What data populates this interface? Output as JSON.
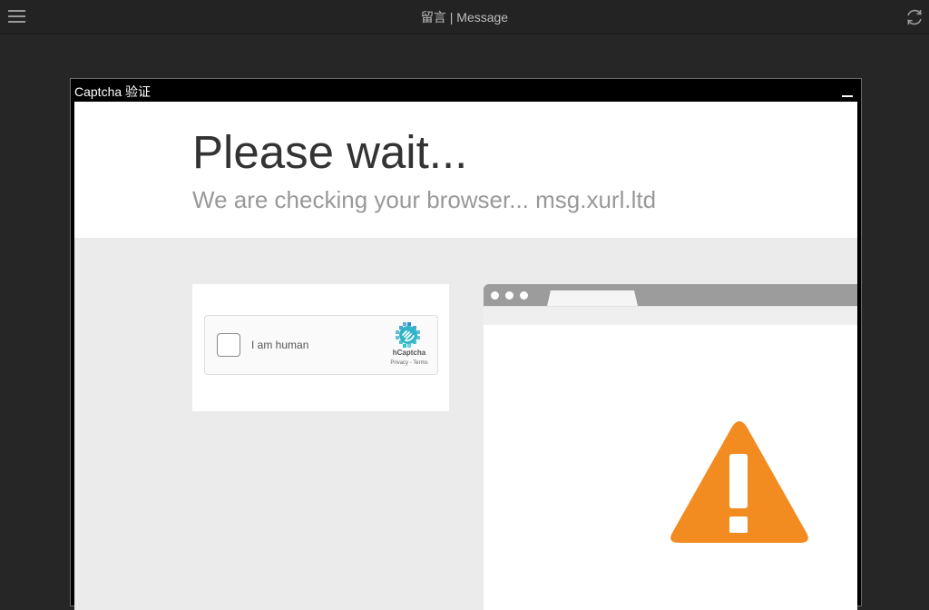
{
  "topbar": {
    "title": "留言 | Message",
    "menu_icon": "hamburger-menu-icon",
    "refresh_icon": "refresh-icon"
  },
  "dialog": {
    "title": "Captcha 验证",
    "minimize_icon": "minimize-icon"
  },
  "page": {
    "heading": "Please wait...",
    "subheading": "We are checking your browser... msg.xurl.ltd"
  },
  "captcha": {
    "checkbox_label": "I am human",
    "brand": "hCaptcha",
    "privacy_link": "Privacy",
    "separator": " - ",
    "terms_link": "Terms",
    "logo_icon": "hcaptcha-logo-icon"
  },
  "illustration": {
    "warning_icon": "warning-triangle-icon",
    "warning_color": "#f28c21"
  },
  "colors": {
    "background": "#262626",
    "topbar": "#232323",
    "content_background": "#ebebeb",
    "heading_text": "#333333",
    "subheading_text": "#999999"
  }
}
